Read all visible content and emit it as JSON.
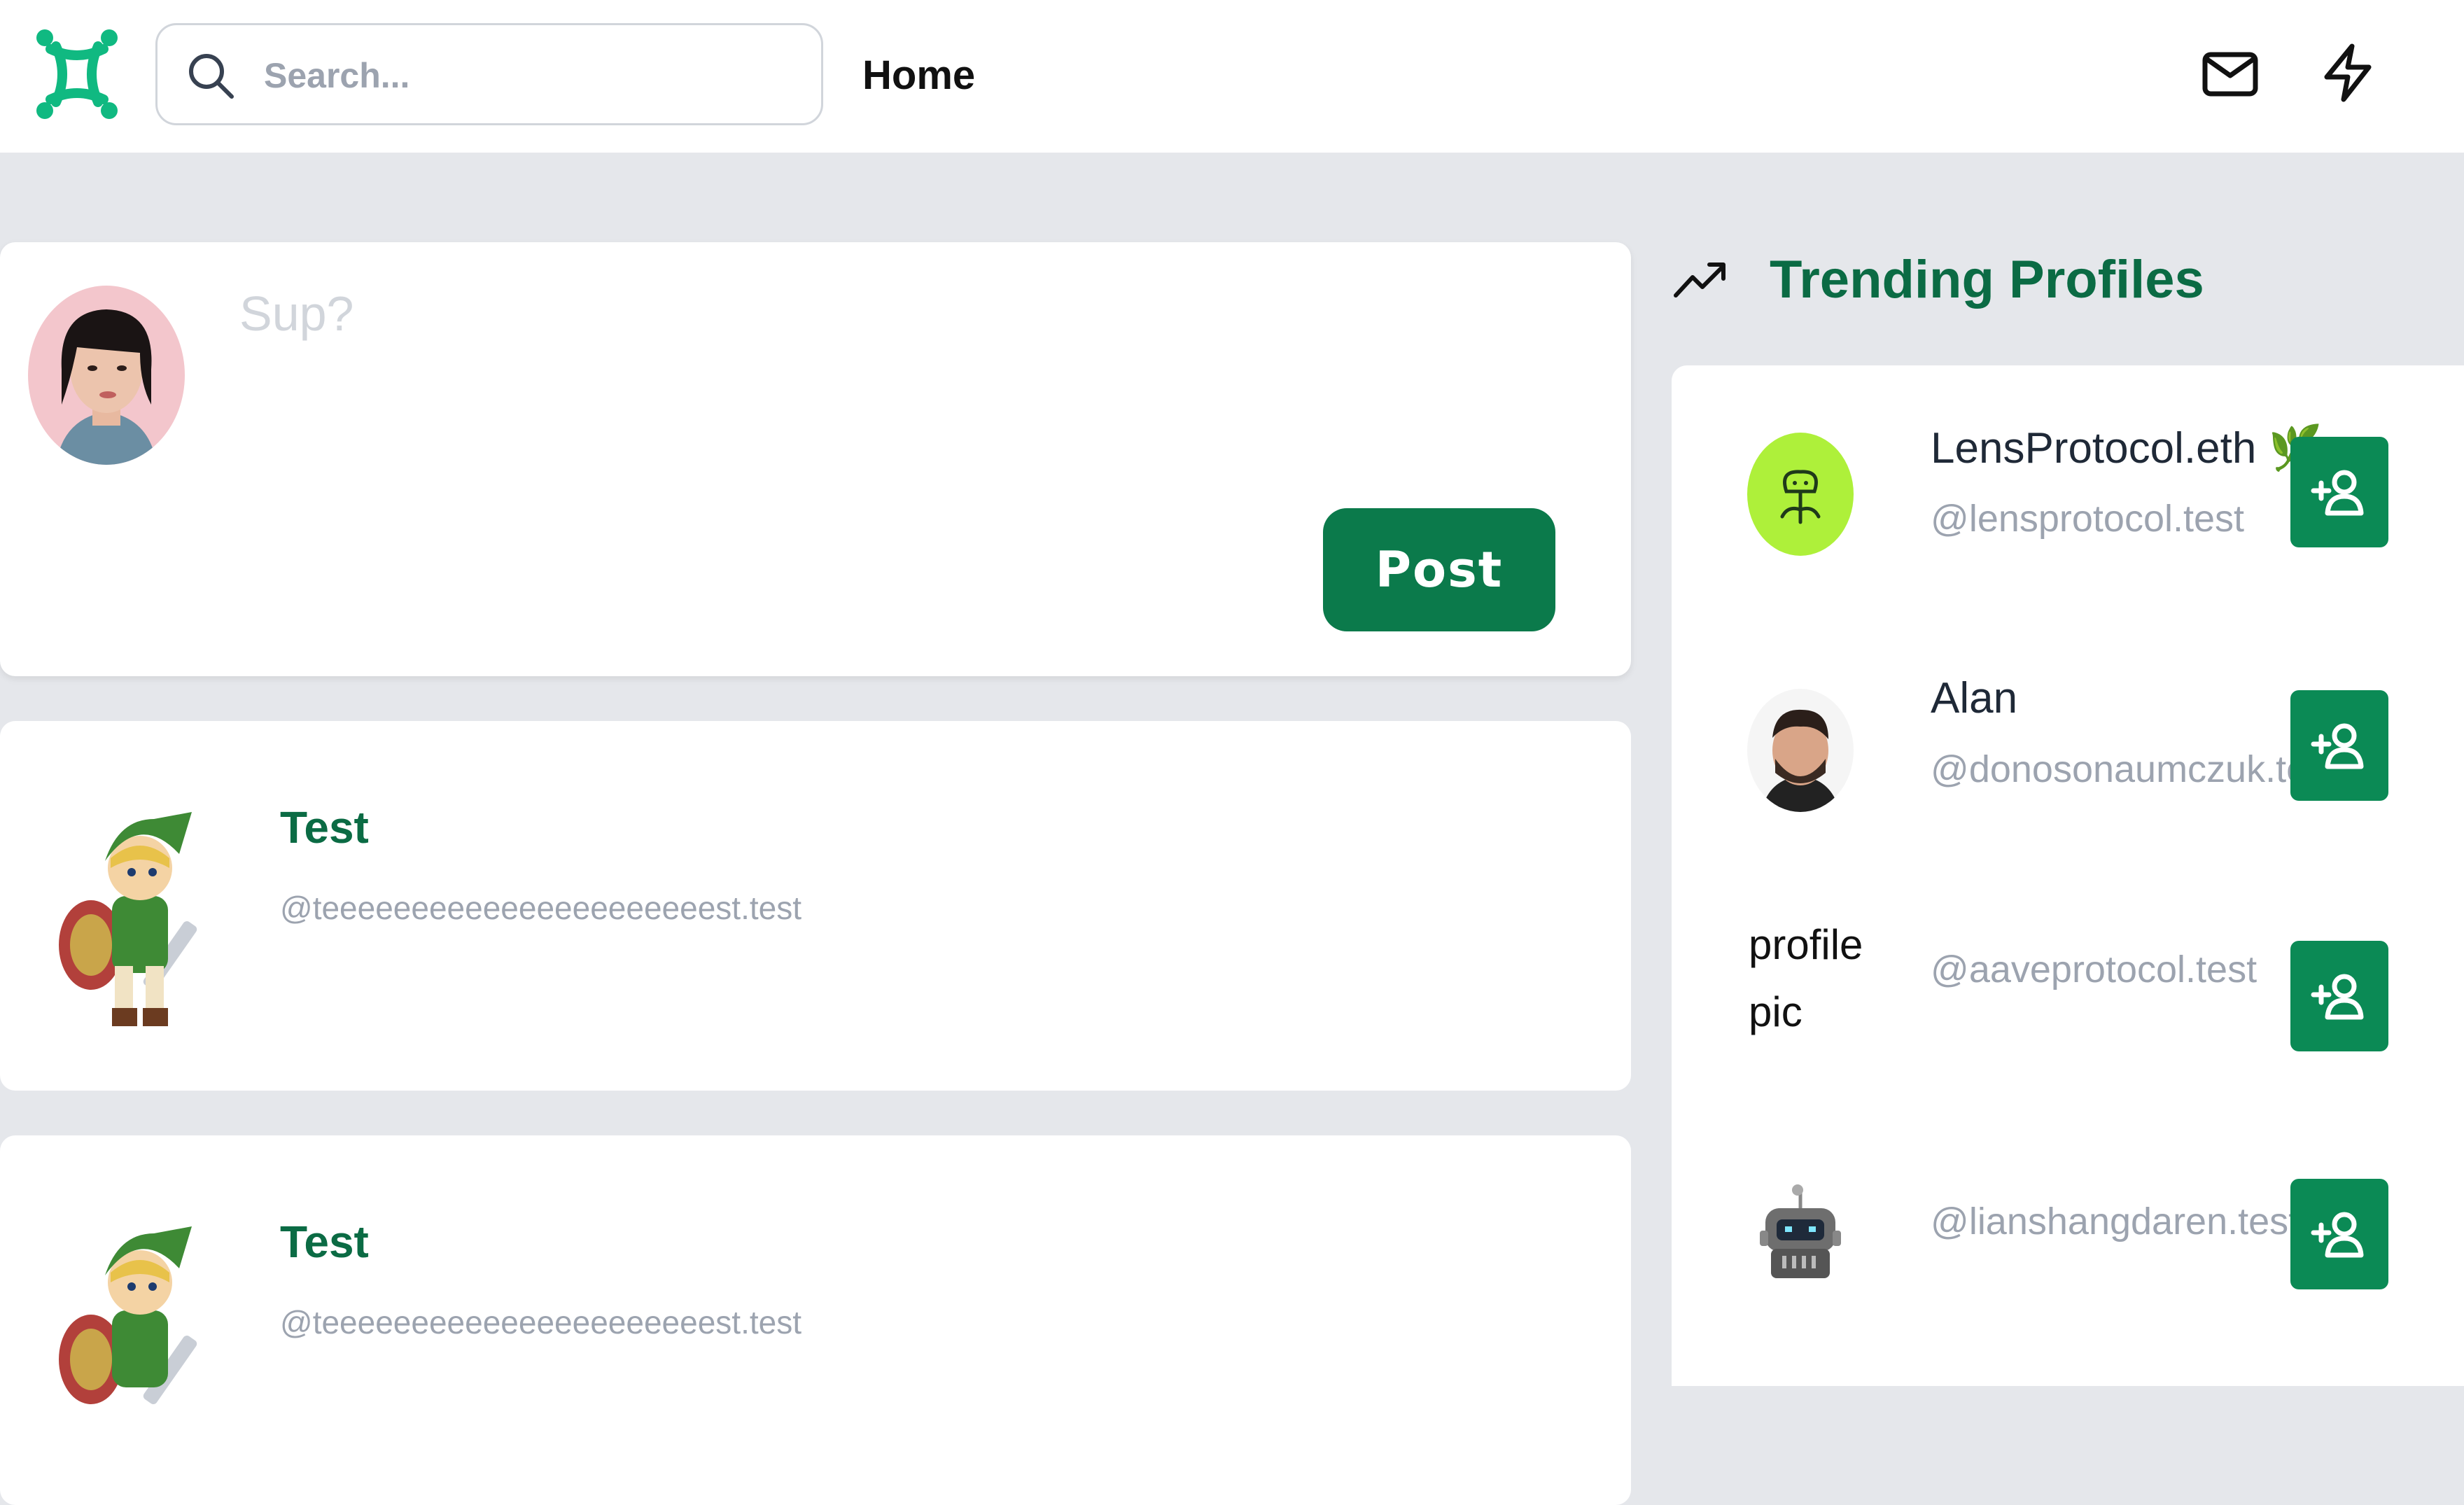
{
  "app": {
    "logo": "lens-logo-icon"
  },
  "header": {
    "search_placeholder": "Search...",
    "title": "Home",
    "icons": [
      "mail-icon",
      "lightning-icon"
    ]
  },
  "composer": {
    "placeholder": "Sup?",
    "post_label": "Post"
  },
  "feed": [
    {
      "name": "Test",
      "handle": "@teeeeeeeeeeeeeeeeeeeeeest.test"
    },
    {
      "name": "Test",
      "handle": "@teeeeeeeeeeeeeeeeeeeeeest.test"
    }
  ],
  "trending": {
    "title": "Trending Profiles",
    "profiles": [
      {
        "name": "LensProtocol.eth 🌿",
        "handle": "@lensprotocol.test"
      },
      {
        "name": "Alan",
        "handle": "@donosonaumczuk.test"
      },
      {
        "name": "",
        "alt": "profile pic",
        "handle": "@aaveprotocol.test"
      },
      {
        "name": "",
        "handle": "@lianshangdaren.test"
      }
    ]
  },
  "colors": {
    "brand": "#0b7a4b",
    "brand_text": "#0b6b44",
    "logo": "#10b981",
    "background": "#e5e7eb"
  }
}
